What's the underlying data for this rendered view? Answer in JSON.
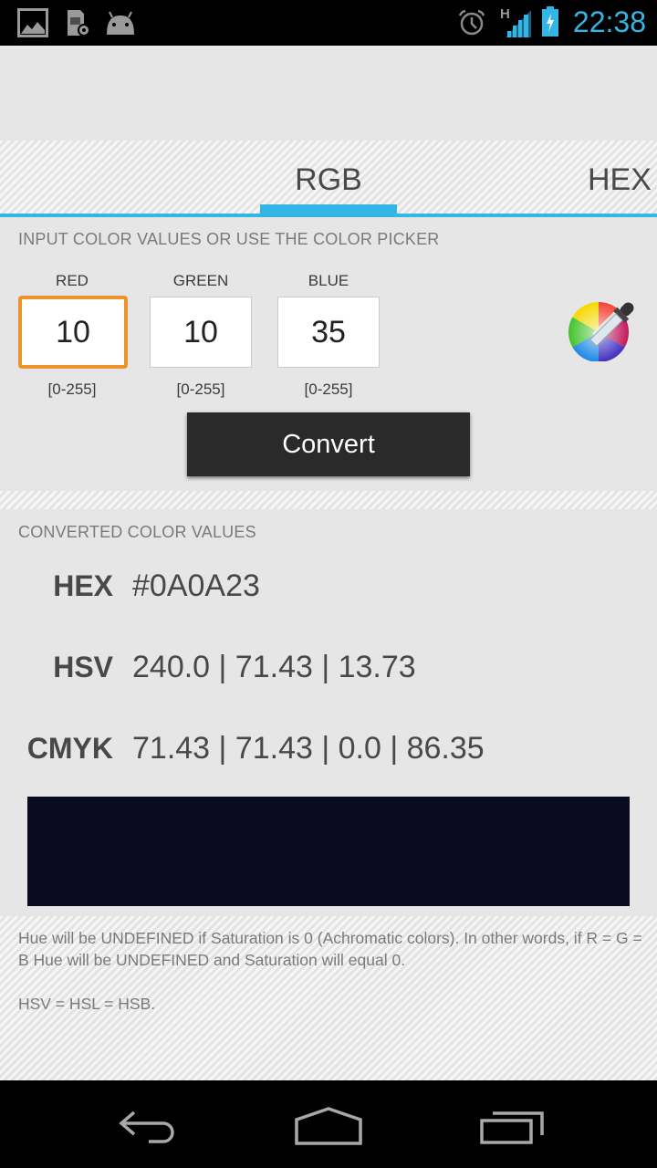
{
  "status_bar": {
    "time": "22:38",
    "network_type": "H",
    "left_icons": [
      "gallery-icon",
      "sd-card-settings-icon",
      "android-icon"
    ],
    "right_icons": [
      "alarm-icon",
      "signal-icon",
      "battery-charging-icon"
    ],
    "accent_color": "#33b5e5"
  },
  "tabs": [
    {
      "label": "RGB",
      "selected": true
    },
    {
      "label": "HEX",
      "selected": false
    }
  ],
  "input_section": {
    "title": "INPUT COLOR VALUES OR USE THE COLOR PICKER",
    "fields": [
      {
        "label": "RED",
        "value": "10",
        "range": "[0-255]",
        "focused": true
      },
      {
        "label": "GREEN",
        "value": "10",
        "range": "[0-255]",
        "focused": false
      },
      {
        "label": "BLUE",
        "value": "35",
        "range": "[0-255]",
        "focused": false
      }
    ],
    "convert_label": "Convert"
  },
  "results": {
    "title": "CONVERTED COLOR VALUES",
    "rows": [
      {
        "label": "HEX",
        "value": "#0A0A23"
      },
      {
        "label": "HSV",
        "value": "240.0 | 71.43 | 13.73"
      },
      {
        "label": "CMYK",
        "value": "71.43 | 71.43 | 0.0 | 86.35"
      }
    ],
    "swatch_color": "#0a0a23"
  },
  "notes": {
    "line1": "Hue will be UNDEFINED if Saturation is 0 (Achromatic colors). In other words, if R = G = B Hue will be UNDEFINED and Saturation will equal 0.",
    "line2": "HSV = HSL = HSB."
  },
  "nav_bar": {
    "buttons": [
      "back",
      "home",
      "recent-apps"
    ]
  }
}
